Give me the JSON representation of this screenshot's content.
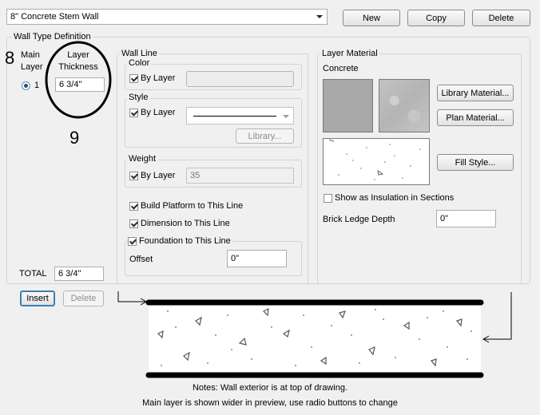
{
  "wall_type_select": {
    "value": "8\" Concrete Stem Wall"
  },
  "top_buttons": {
    "new": "New",
    "copy": "Copy",
    "delete": "Delete"
  },
  "definition": {
    "title": "Wall Type Definition",
    "main_layer_header": "Main\nLayer",
    "thickness_header": "Layer\nThickness",
    "layer_number": "1",
    "layer_thickness": "6 3/4\"",
    "total_label": "TOTAL",
    "total_value": "6 3/4\"",
    "insert_label": "Insert",
    "delete_label": "Delete"
  },
  "annotations": {
    "left_number": "8",
    "below_number": "9"
  },
  "wall_line": {
    "title": "Wall Line",
    "color": {
      "title": "Color",
      "by_layer_label": "By Layer",
      "by_layer_checked": true
    },
    "style": {
      "title": "Style",
      "by_layer_label": "By Layer",
      "by_layer_checked": true,
      "library_label": "Library..."
    },
    "weight": {
      "title": "Weight",
      "by_layer_label": "By Layer",
      "by_layer_checked": true,
      "value": "35"
    },
    "build_platform": {
      "label": "Build Platform to This Line",
      "checked": true
    },
    "dimension": {
      "label": "Dimension to This Line",
      "checked": true
    },
    "foundation": {
      "label": "Foundation to This Line",
      "checked": true
    },
    "offset_label": "Offset",
    "offset_value": "0\""
  },
  "layer_material": {
    "title": "Layer Material",
    "material_name": "Concrete",
    "library_material_label": "Library Material...",
    "plan_material_label": "Plan Material...",
    "fill_style_label": "Fill Style...",
    "insulation_label": "Show as Insulation in Sections",
    "insulation_checked": false,
    "brick_ledge_label": "Brick Ledge Depth",
    "brick_ledge_value": "0\""
  },
  "colors": {
    "swatch_gray": "#a8a8a8",
    "concrete_gray": "#bdbdbd",
    "focus_blue": "#3c7fb1"
  },
  "notes": {
    "line1": "Notes:  Wall exterior is at top of drawing.",
    "line2": "Main layer is shown wider in preview, use radio buttons to change"
  }
}
